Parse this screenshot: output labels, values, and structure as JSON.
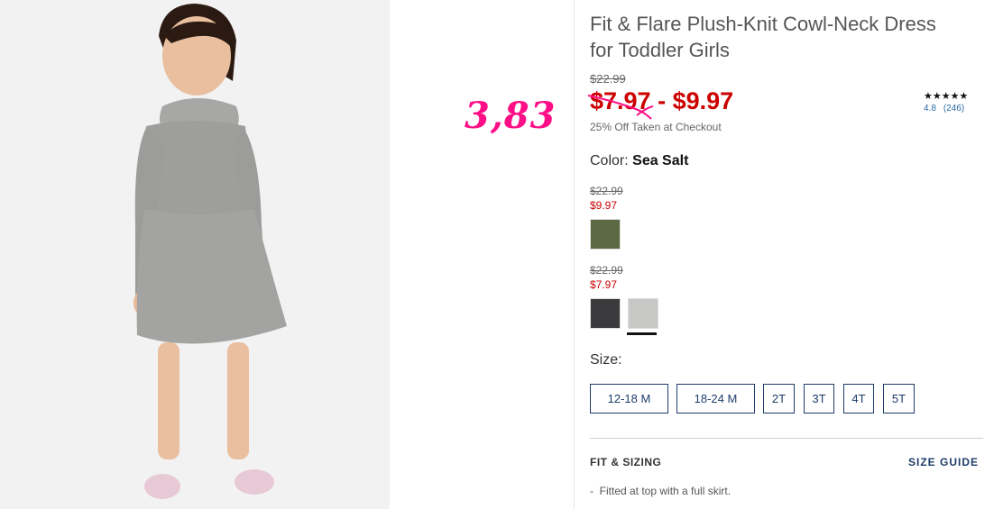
{
  "handwritten_note": "3,83",
  "product": {
    "title_line1": "Fit & Flare Plush-Knit Cowl-Neck Dress",
    "title_line2": "for Toddler Girls",
    "original_price": "$22.99",
    "sale_price_low": "$7.97",
    "sale_price_sep": " - ",
    "sale_price_high": "$9.97",
    "promo": "25% Off Taken at Checkout",
    "rating_stars": "★★★★★",
    "rating_value": "4.8",
    "rating_count": "(246)"
  },
  "color": {
    "label": "Color:",
    "selected": "Sea Salt",
    "groups": [
      {
        "original": "$22.99",
        "sale": "$9.97",
        "swatches": [
          "olive"
        ]
      },
      {
        "original": "$22.99",
        "sale": "$7.97",
        "swatches": [
          "charcoal",
          "sea-salt"
        ]
      }
    ],
    "swatch_colors": {
      "olive": "#5c6a44",
      "charcoal": "#3b3b3d",
      "sea-salt": "#c8c8c6"
    }
  },
  "size": {
    "label": "Size:",
    "options": [
      "12-18 M",
      "18-24 M",
      "2T",
      "3T",
      "4T",
      "5T"
    ]
  },
  "fit": {
    "heading": "FIT & SIZING",
    "size_guide": "SIZE GUIDE",
    "bullet": "-  Fitted at top with a full skirt."
  },
  "colors": {
    "sale_red": "#cc0000",
    "navy": "#1e3c6b",
    "pink_note": "#ff0f87"
  }
}
